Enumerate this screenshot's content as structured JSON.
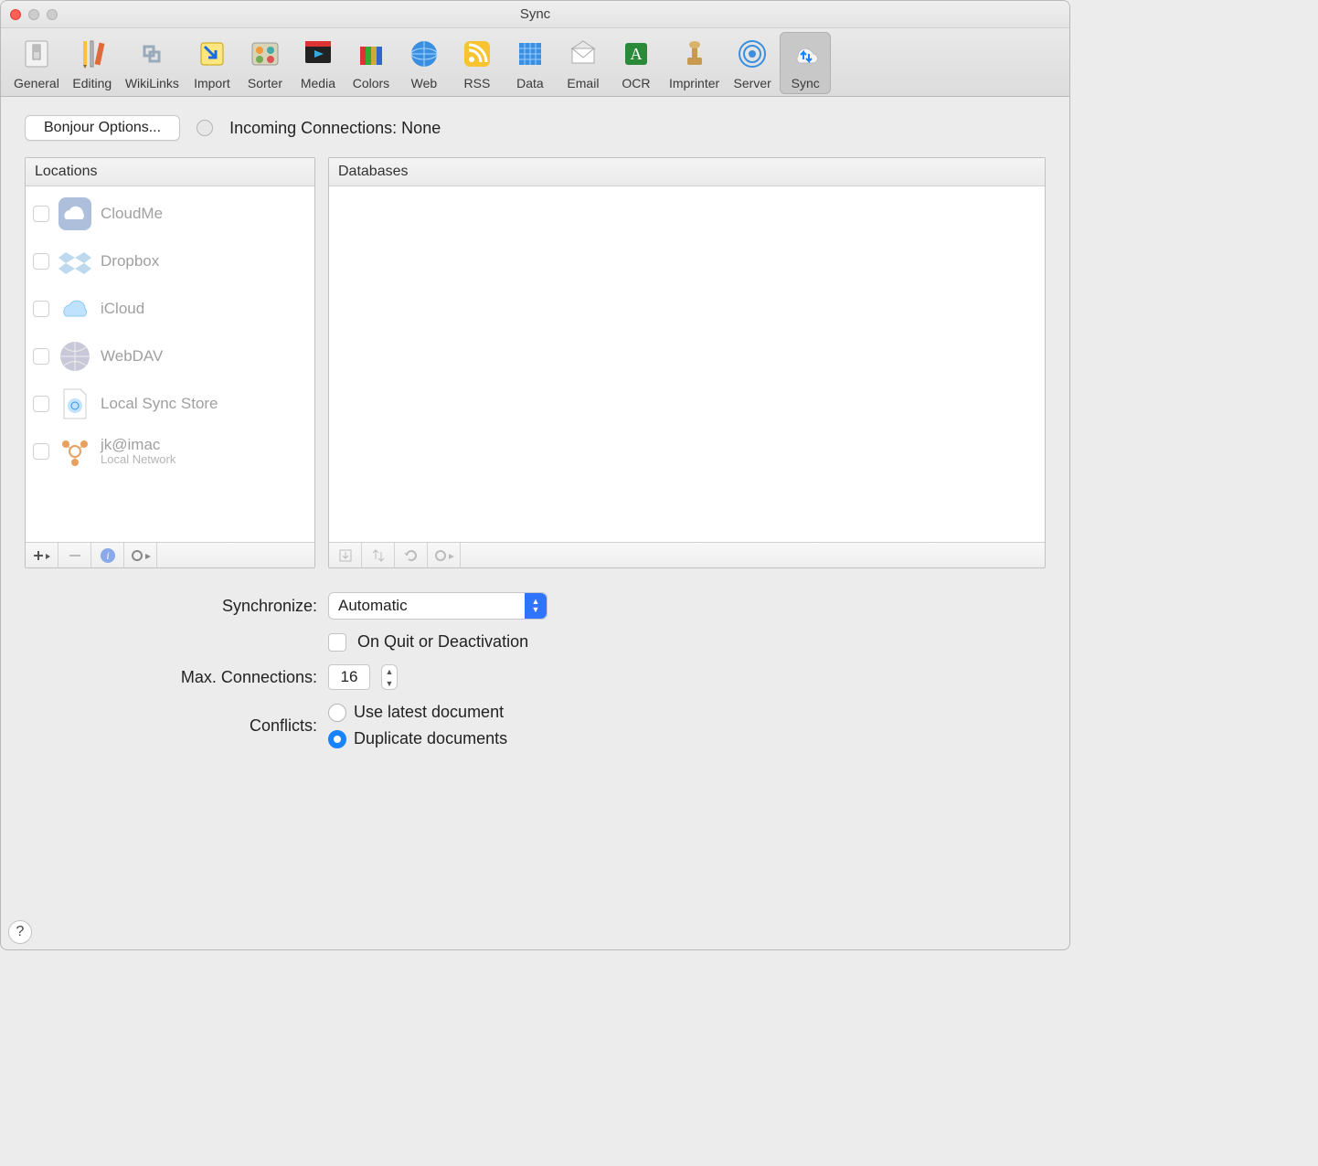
{
  "window": {
    "title": "Sync"
  },
  "toolbar": {
    "items": [
      {
        "label": "General"
      },
      {
        "label": "Editing"
      },
      {
        "label": "WikiLinks"
      },
      {
        "label": "Import"
      },
      {
        "label": "Sorter"
      },
      {
        "label": "Media"
      },
      {
        "label": "Colors"
      },
      {
        "label": "Web"
      },
      {
        "label": "RSS"
      },
      {
        "label": "Data"
      },
      {
        "label": "Email"
      },
      {
        "label": "OCR"
      },
      {
        "label": "Imprinter"
      },
      {
        "label": "Server"
      },
      {
        "label": "Sync"
      }
    ],
    "active_index": 14
  },
  "top": {
    "bonjour_button": "Bonjour Options...",
    "incoming_label": "Incoming Connections: None"
  },
  "locations": {
    "header": "Locations",
    "items": [
      {
        "label": "CloudMe",
        "sub": ""
      },
      {
        "label": "Dropbox",
        "sub": ""
      },
      {
        "label": "iCloud",
        "sub": ""
      },
      {
        "label": "WebDAV",
        "sub": ""
      },
      {
        "label": "Local Sync Store",
        "sub": ""
      },
      {
        "label": "jk@imac",
        "sub": "Local Network"
      }
    ]
  },
  "databases": {
    "header": "Databases"
  },
  "form": {
    "synchronize_label": "Synchronize:",
    "synchronize_value": "Automatic",
    "on_quit_label": "On Quit or Deactivation",
    "max_conn_label": "Max. Connections:",
    "max_conn_value": "16",
    "conflicts_label": "Conflicts:",
    "conflicts_options": [
      "Use latest document",
      "Duplicate documents"
    ],
    "conflicts_selected": 1
  },
  "help": "?"
}
